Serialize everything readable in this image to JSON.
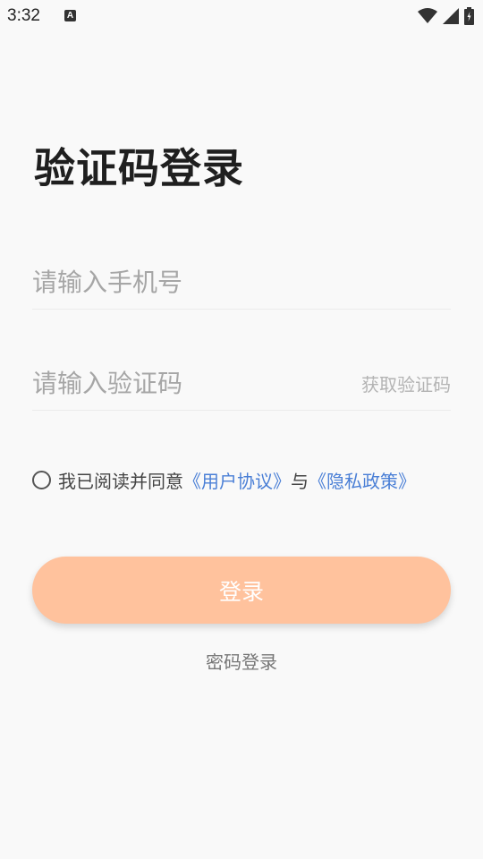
{
  "status_bar": {
    "time": "3:32",
    "notification_icon": "a-icon",
    "icons": [
      "wifi-icon",
      "signal-icon",
      "battery-icon"
    ]
  },
  "page": {
    "title": "验证码登录"
  },
  "form": {
    "phone_placeholder": "请输入手机号",
    "phone_value": "",
    "code_placeholder": "请输入验证码",
    "code_value": "",
    "get_code_label": "获取验证码"
  },
  "agreement": {
    "checked": false,
    "prefix": "我已阅读并同意",
    "user_agreement": "《用户协议》",
    "connector": "与",
    "privacy_policy": "《隐私政策》"
  },
  "actions": {
    "login_label": "登录",
    "password_login_label": "密码登录"
  },
  "colors": {
    "button_bg": "#ffc29d",
    "link": "#4a7fd6",
    "background": "#f9f9f9"
  }
}
